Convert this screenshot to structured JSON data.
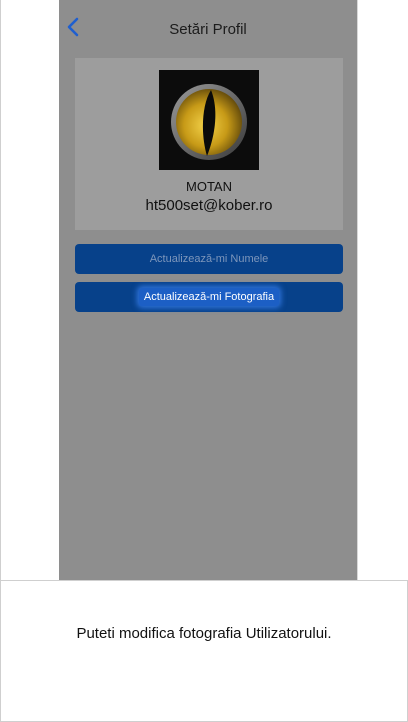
{
  "header": {
    "title": "Setări Profil",
    "back_icon": "chevron-left-icon"
  },
  "profile": {
    "avatar_icon": "cat-eye-logo",
    "name": "MOTAN",
    "email": "ht500set@kober.ro"
  },
  "actions": {
    "update_name_label": "Actualizează-mi Numele",
    "update_photo_label": "Actualizează-mi Fotografia"
  },
  "caption": {
    "text": "Puteti modifica fotografia Utilizatorului."
  },
  "colors": {
    "overlay": "#8e8e8e",
    "button_blue": "#07418a",
    "highlight": "#1c5fc5",
    "back_arrow": "#1f5fcf"
  }
}
